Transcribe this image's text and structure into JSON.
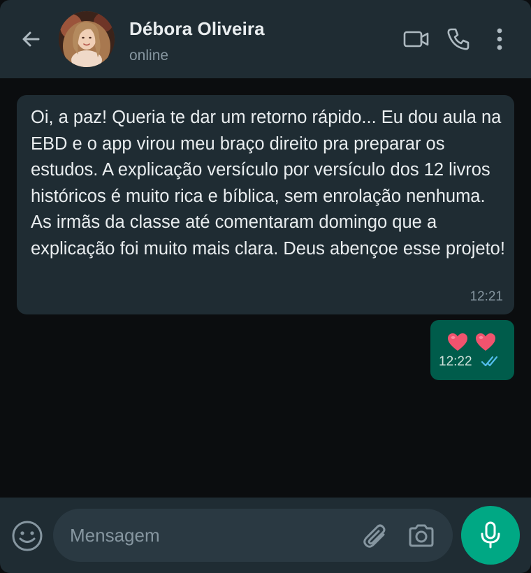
{
  "header": {
    "contact_name": "Débora Oliveira",
    "status": "online",
    "icons": {
      "back": "arrow-left-icon",
      "avatar": "contact-photo",
      "video": "video-call-icon",
      "voice": "phone-call-icon",
      "menu": "more-vertical-icon"
    }
  },
  "messages": [
    {
      "direction": "incoming",
      "text": "Oi, a paz! Queria te dar um retorno rápido... Eu dou aula na EBD e o app virou meu braço direito pra preparar os estudos. A explicação versículo por versículo dos 12 livros históricos é muito rica e bíblica, sem enrolação nenhuma. As irmãs da classe até comentaram domingo que a explicação foi muito mais clara. Deus abençoe esse projeto!",
      "time": "12:21"
    },
    {
      "direction": "outgoing",
      "content": "two-hearts-emoji",
      "emoji_count": 2,
      "time": "12:22",
      "status": "read-double-check"
    }
  ],
  "composer": {
    "placeholder": "Mensagem",
    "value": "",
    "icons": {
      "emoji": "smiley-icon",
      "attach": "paperclip-icon",
      "camera": "camera-icon",
      "mic": "microphone-icon"
    }
  },
  "colors": {
    "header_bg": "#1f2c33",
    "chat_bg": "#0b0d0f",
    "incoming_bubble": "#1f2c33",
    "outgoing_bubble": "#005c4b",
    "accent": "#00a884",
    "read_ticks": "#53bdeb",
    "heart": "#f0536e"
  }
}
